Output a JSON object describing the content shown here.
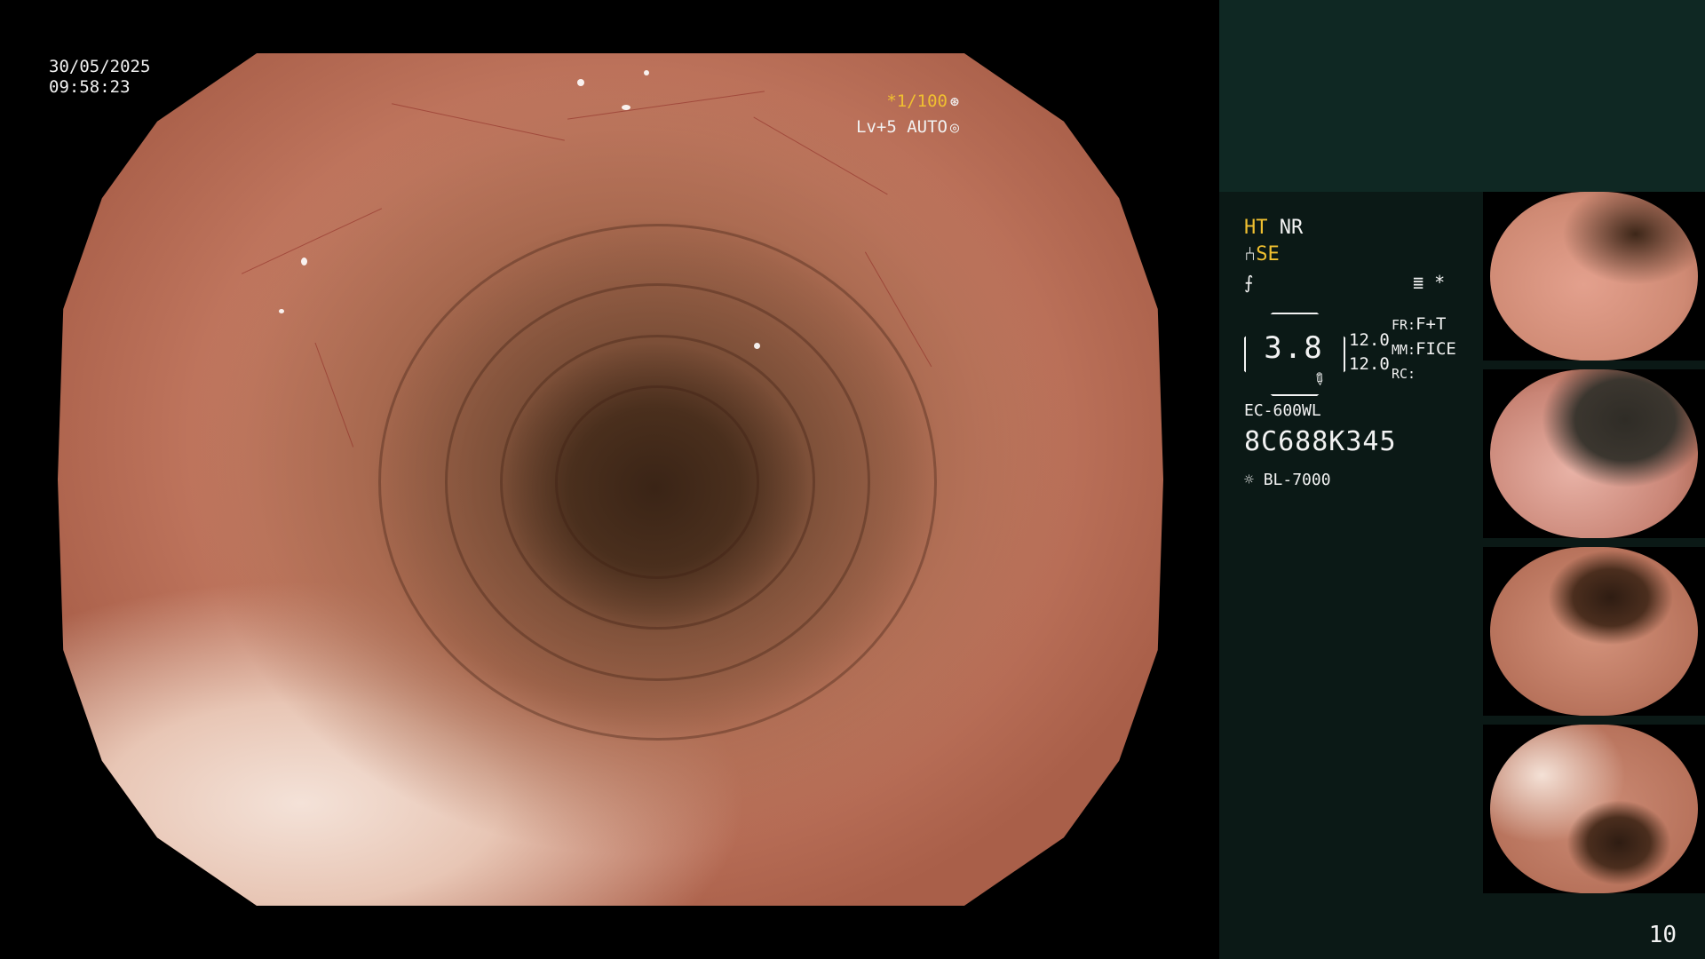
{
  "overlay": {
    "date": "30/05/2025",
    "time": "09:58:23",
    "shutter": "*1/100",
    "shutter_icon": "aperture-icon",
    "level": "Lv+5 AUTO",
    "level_icon": "iris-icon"
  },
  "panel": {
    "ht": "HT",
    "nr": "NR",
    "se": "SE",
    "symbol_se": "⑃",
    "symbol_f": "⨍",
    "mode_icon_glyph": "≣",
    "asterisk": "*",
    "oct_value": "3.8",
    "val1": "12.0",
    "val2": "12.0",
    "fr_label": "FR:",
    "fr_value": "F+T",
    "mm_label": "MM:",
    "mm_value": "FICE",
    "rc_label": "RC:",
    "scope_model": "EC-600WL",
    "serial": "8C688K345",
    "light_source": "BL-7000"
  },
  "page_number": "10",
  "colors": {
    "accent_yellow": "#f0c030",
    "panel_bg": "#0b1916",
    "panel_top_bg": "#0f2823"
  }
}
